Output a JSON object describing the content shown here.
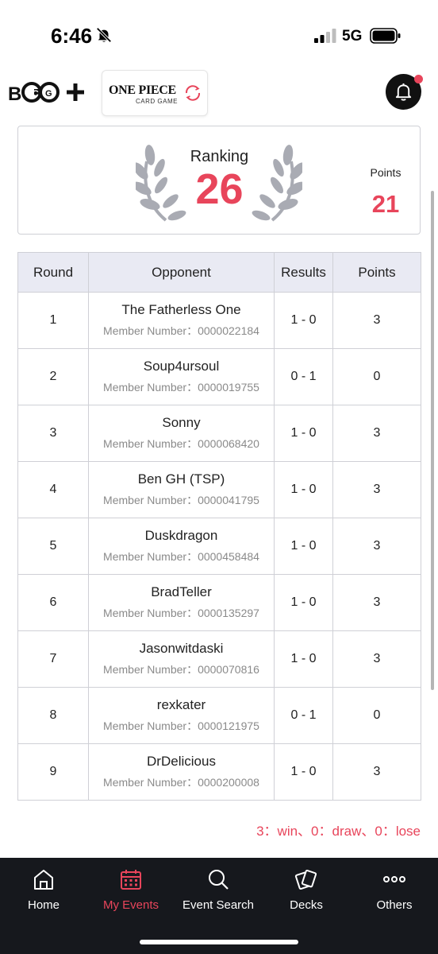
{
  "status_bar": {
    "time": "6:46",
    "network": "5G"
  },
  "header": {
    "bandai_logo_text": "BNTCG+",
    "one_piece_logo_title": "ONE PIECE",
    "one_piece_logo_subtitle": "CARD GAME",
    "notification_badge": true
  },
  "ranking_card": {
    "ranking_label": "Ranking",
    "ranking_value": "26",
    "points_label": "Points",
    "points_value": "21"
  },
  "table": {
    "headers": [
      "Round",
      "Opponent",
      "Results",
      "Points"
    ],
    "rows": [
      {
        "round": "1",
        "opponent": "The Fatherless One",
        "member": "Member Number：0000022184",
        "result": "1 - 0",
        "points": "3"
      },
      {
        "round": "2",
        "opponent": "Soup4ursoul",
        "member": "Member Number：0000019755",
        "result": "0 - 1",
        "points": "0"
      },
      {
        "round": "3",
        "opponent": "Sonny",
        "member": "Member Number：0000068420",
        "result": "1 - 0",
        "points": "3"
      },
      {
        "round": "4",
        "opponent": "Ben GH (TSP)",
        "member": "Member Number：0000041795",
        "result": "1 - 0",
        "points": "3"
      },
      {
        "round": "5",
        "opponent": "Duskdragon",
        "member": "Member Number：0000458484",
        "result": "1 - 0",
        "points": "3"
      },
      {
        "round": "6",
        "opponent": "BradTeller",
        "member": "Member Number：0000135297",
        "result": "1 - 0",
        "points": "3"
      },
      {
        "round": "7",
        "opponent": "Jasonwitdaski",
        "member": "Member Number：0000070816",
        "result": "1 - 0",
        "points": "3"
      },
      {
        "round": "8",
        "opponent": "rexkater",
        "member": "Member Number：0000121975",
        "result": "0 - 1",
        "points": "0"
      },
      {
        "round": "9",
        "opponent": "DrDelicious",
        "member": "Member Number：0000200008",
        "result": "1 - 0",
        "points": "3"
      }
    ]
  },
  "legend": "3：win、0：draw、0：lose",
  "bottom_nav": {
    "items": [
      {
        "label": "Home",
        "icon": "home-icon"
      },
      {
        "label": "My Events",
        "icon": "calendar-icon",
        "active": true
      },
      {
        "label": "Event Search",
        "icon": "search-icon"
      },
      {
        "label": "Decks",
        "icon": "cards-icon"
      },
      {
        "label": "Others",
        "icon": "more-dots-icon"
      }
    ]
  },
  "colors": {
    "accent": "#e8455b",
    "nav_bg": "#16181d",
    "table_header_bg": "#e9eaf3",
    "border": "#cfd0d6"
  }
}
